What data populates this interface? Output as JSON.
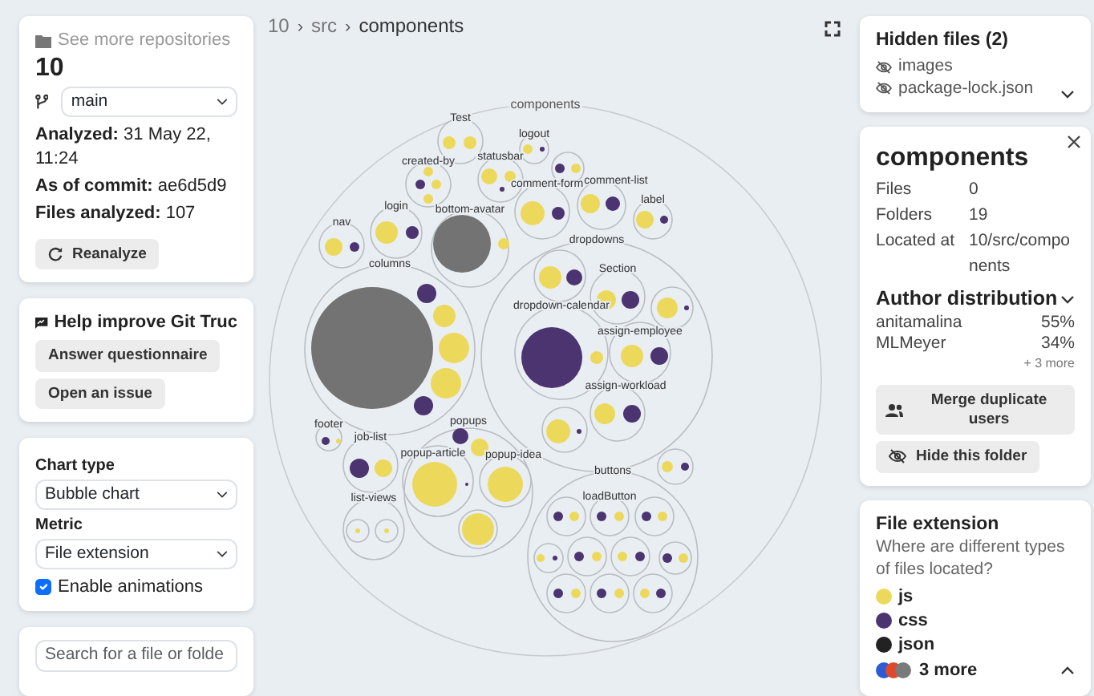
{
  "repo": {
    "link": "See more repositories",
    "name": "10",
    "branch": "main",
    "analyzed": "**Analyzed:** 31 May 22, 11:24",
    "commit": "**As of commit:** ae6d5d9",
    "files": "**Files analyzed:** 107",
    "reanalyze": "Reanalyze"
  },
  "feedback": {
    "title": "Help improve Git Truc",
    "buttons": [
      "Answer questionnaire",
      "Open an issue"
    ]
  },
  "settings": {
    "chart_type_label": "Chart type",
    "chart_type": "Bubble chart",
    "metric_label": "Metric",
    "metric": "File extension",
    "animations": {
      "label": "Enable animations",
      "checked": true
    }
  },
  "search": {
    "placeholder": "Search for a file or folde"
  },
  "breadcrumb": {
    "items": [
      "10",
      "src",
      "components"
    ],
    "separator": "›"
  },
  "chart": {
    "label": "components",
    "children": [
      {
        "label": "Test",
        "children": [
          {
            "kind": "js"
          },
          {
            "kind": "js"
          }
        ]
      },
      {
        "label": "logout",
        "children": [
          {
            "kind": "js"
          },
          {
            "kind": "css"
          }
        ]
      },
      {
        "children": [
          {
            "kind": "css"
          },
          {
            "kind": "js"
          }
        ]
      },
      {
        "label": "created-by",
        "children": [
          {
            "kind": "js"
          },
          {
            "kind": "css"
          },
          {
            "kind": "js"
          },
          {
            "kind": "js"
          }
        ]
      },
      {
        "label": "statusbar",
        "children": [
          {
            "kind": "js"
          },
          {
            "kind": "js"
          },
          {
            "kind": "css"
          }
        ]
      },
      {
        "label": "comment-form",
        "children": [
          {
            "kind": "js"
          },
          {
            "kind": "css"
          }
        ]
      },
      {
        "label": "comment-list",
        "children": [
          {
            "kind": "js"
          },
          {
            "kind": "css"
          }
        ]
      },
      {
        "label": "label",
        "children": [
          {
            "kind": "js"
          },
          {
            "kind": "css"
          }
        ]
      },
      {
        "label": "nav",
        "children": [
          {
            "kind": "js"
          },
          {
            "kind": "css"
          }
        ]
      },
      {
        "label": "login",
        "children": [
          {
            "kind": "js"
          },
          {
            "kind": "css"
          }
        ]
      },
      {
        "label": "bottom-avatar",
        "children": [
          {
            "kind": "other"
          },
          {
            "kind": "js"
          }
        ]
      },
      {
        "label": "columns",
        "children": [
          {
            "kind": "other"
          },
          {
            "kind": "css"
          },
          {
            "kind": "js"
          },
          {
            "kind": "js"
          },
          {
            "kind": "js"
          },
          {
            "kind": "css"
          }
        ]
      },
      {
        "label": "dropdowns",
        "children": [
          {
            "children": [
              {
                "kind": "js"
              },
              {
                "kind": "css"
              }
            ]
          },
          {
            "label": "Section",
            "children": [
              {
                "kind": "js"
              },
              {
                "kind": "css"
              }
            ]
          },
          {
            "children": [
              {
                "kind": "js"
              },
              {
                "kind": "css"
              }
            ]
          },
          {
            "label": "dropdown-calendar",
            "children": [
              {
                "kind": "css"
              },
              {
                "kind": "js"
              }
            ]
          },
          {
            "label": "assign-employee",
            "children": [
              {
                "kind": "js"
              },
              {
                "kind": "css"
              }
            ]
          },
          {
            "label": "assign-workload",
            "children": [
              {
                "kind": "js"
              },
              {
                "kind": "css"
              }
            ]
          },
          {
            "children": [
              {
                "kind": "js"
              },
              {
                "kind": "css"
              }
            ]
          }
        ]
      },
      {
        "label": "footer",
        "children": [
          {
            "kind": "css"
          },
          {
            "kind": "js"
          }
        ]
      },
      {
        "label": "job-list",
        "children": [
          {
            "kind": "css"
          },
          {
            "kind": "js"
          }
        ]
      },
      {
        "label": "popups",
        "children": [
          {
            "kind": "css"
          },
          {
            "kind": "js"
          },
          {
            "label": "popup-article",
            "children": [
              {
                "kind": "js"
              },
              {
                "kind": "css"
              }
            ]
          },
          {
            "label": "popup-idea",
            "children": [
              {
                "kind": "js"
              }
            ]
          },
          {
            "children": [
              {
                "kind": "js"
              }
            ]
          }
        ]
      },
      {
        "label": "list-views",
        "children": [
          {
            "children": [
              {
                "kind": "js"
              }
            ]
          },
          {
            "children": [
              {
                "kind": "js"
              }
            ]
          }
        ]
      },
      {
        "children": [
          {
            "kind": "js"
          },
          {
            "kind": "css"
          }
        ]
      },
      {
        "label": "buttons",
        "children": [
          {
            "children": [
              {
                "kind": "css"
              },
              {
                "kind": "js"
              }
            ]
          },
          {
            "label": "loadButton",
            "children": [
              {
                "kind": "css"
              },
              {
                "kind": "js"
              }
            ]
          },
          {
            "children": [
              {
                "kind": "css"
              },
              {
                "kind": "js"
              }
            ]
          },
          {
            "children": [
              {
                "kind": "js"
              },
              {
                "kind": "css"
              }
            ]
          },
          {
            "children": [
              {
                "kind": "css"
              },
              {
                "kind": "js"
              }
            ]
          },
          {
            "children": [
              {
                "kind": "js"
              },
              {
                "kind": "css"
              }
            ]
          },
          {
            "children": [
              {
                "kind": "css"
              },
              {
                "kind": "js"
              }
            ]
          },
          {
            "children": [
              {
                "kind": "css"
              },
              {
                "kind": "js"
              }
            ]
          },
          {
            "children": [
              {
                "kind": "css"
              },
              {
                "kind": "js"
              }
            ]
          },
          {
            "children": [
              {
                "kind": "js"
              },
              {
                "kind": "css"
              }
            ]
          }
        ]
      }
    ]
  },
  "hidden_files": {
    "title": "Hidden files (2)",
    "items": [
      "images",
      "package-lock.json"
    ]
  },
  "details": {
    "title": "components",
    "rows": [
      {
        "label": "Files",
        "value": "0"
      },
      {
        "label": "Folders",
        "value": "19"
      },
      {
        "label": "Located at",
        "value": "10/src/components"
      }
    ],
    "authors_title": "Author distribution",
    "authors": [
      {
        "name": "anitamalina",
        "share": "55%"
      },
      {
        "name": "MLMeyer",
        "share": "34%"
      }
    ],
    "more": "+ 3 more",
    "merge": "Merge duplicate users",
    "hide": "Hide this folder"
  },
  "legend": {
    "title": "File extension",
    "description": "Where are different types of files located?",
    "items": [
      {
        "kind": "js",
        "label": "js",
        "color": "#ecd95c"
      },
      {
        "kind": "css",
        "label": "css",
        "color": "#4b3470"
      },
      {
        "kind": "json",
        "label": "json",
        "color": "#222222"
      }
    ],
    "more": {
      "label": "3 more"
    }
  }
}
